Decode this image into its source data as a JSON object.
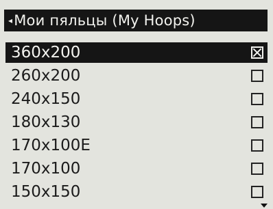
{
  "header": {
    "back_icon": "left-arrow-icon",
    "title": "Мои пяльцы (My Hoops)"
  },
  "hoops": [
    {
      "label": "360x200",
      "checked": true
    },
    {
      "label": "260x200",
      "checked": false
    },
    {
      "label": "240x150",
      "checked": false
    },
    {
      "label": "180x130",
      "checked": false
    },
    {
      "label": "170x100E",
      "checked": false
    },
    {
      "label": "170x100",
      "checked": false
    },
    {
      "label": "150x150",
      "checked": false
    }
  ],
  "selected_index": 0,
  "scroll": {
    "indicator_icon": "scroll-down-arrow-icon"
  }
}
